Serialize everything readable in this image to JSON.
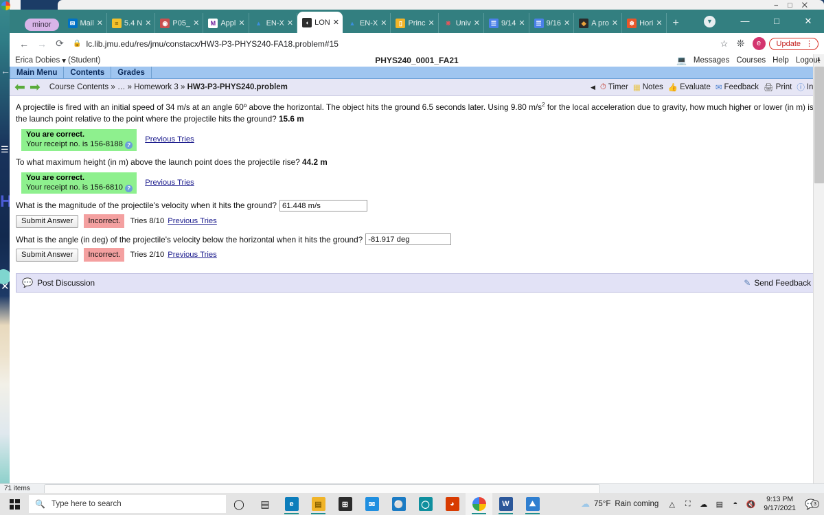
{
  "desktop": {
    "taskbar": {
      "search_placeholder": "Type here to search",
      "start_name": "windows-start",
      "apps": [
        {
          "name": "edge",
          "glyph": "e",
          "color": "#0c7dbb",
          "running": true
        },
        {
          "name": "file-explorer",
          "glyph": "▤",
          "color": "#f0b429",
          "running": true
        },
        {
          "name": "microsoft-store",
          "glyph": "⊞",
          "color": "#2b2b2b",
          "running": false
        },
        {
          "name": "mail",
          "glyph": "✉",
          "color": "#1f8fe0",
          "running": false
        },
        {
          "name": "skype",
          "glyph": "⊝",
          "color": "#1b7bc4",
          "running": false
        },
        {
          "name": "cortana",
          "glyph": "◯",
          "color": "#0f8f9e",
          "running": false
        },
        {
          "name": "office",
          "glyph": "◗",
          "color": "#d83b01",
          "running": false
        },
        {
          "name": "chrome",
          "glyph": "◉",
          "color": "#ffffff",
          "running": true,
          "active": true
        },
        {
          "name": "word",
          "glyph": "W",
          "color": "#2b579a",
          "running": true
        },
        {
          "name": "photos",
          "glyph": "⛰",
          "color": "#2f7fd0",
          "running": true
        }
      ],
      "weather_temp": "75°F",
      "weather_text": "Rain coming",
      "time": "9:13 PM",
      "date": "9/17/2021",
      "notification_count": "3",
      "tray_icons": [
        "chevron-up",
        "camera",
        "onedrive-sync",
        "battery",
        "wifi",
        "volume-mute"
      ]
    },
    "explorer_status": {
      "item_count": "71 items"
    }
  },
  "browser": {
    "pinned_tab_label": "minor",
    "tabs": [
      {
        "label": "Mail",
        "fav": "✉",
        "fav_color": "#0072c6",
        "active": false
      },
      {
        "label": "5.4 N",
        "fav": "≡",
        "fav_color": "#f3c12c",
        "active": false
      },
      {
        "label": "P05_",
        "fav": "◔",
        "fav_color": "#c94f4f",
        "active": false
      },
      {
        "label": "Appl",
        "fav": "M",
        "fav_color": "#6a1b9a",
        "active": false
      },
      {
        "label": "EN-X",
        "fav": "△",
        "fav_color": "#1a73e8",
        "active": false
      },
      {
        "label": "LON",
        "fav": "◕",
        "fav_color": "#333333",
        "active": true
      },
      {
        "label": "EN-X",
        "fav": "△",
        "fav_color": "#1a73e8",
        "active": false
      },
      {
        "label": "Princ",
        "fav": "▤",
        "fav_color": "#f0b429",
        "active": false
      },
      {
        "label": "Univ",
        "fav": "✹",
        "fav_color": "#e03a3a",
        "active": false
      },
      {
        "label": "9/14",
        "fav": "☰",
        "fav_color": "#4a80e8",
        "active": false
      },
      {
        "label": "9/16",
        "fav": "☰",
        "fav_color": "#4a80e8",
        "active": false
      },
      {
        "label": "A pro",
        "fav": "◆",
        "fav_color": "#e8a33d",
        "active": false
      },
      {
        "label": "Hori",
        "fav": "❄",
        "fav_color": "#e8562a",
        "active": false
      }
    ],
    "new_tab_glyph": "+",
    "window_controls": {
      "minimize": "—",
      "maximize": "□",
      "close": "✕"
    },
    "nav": {
      "back": "←",
      "forward": "→",
      "reload": "⟳"
    },
    "omnibox": {
      "lock_icon": "🔒",
      "url_host": "lc.lib.jmu.edu",
      "url_path": "/res/jmu/constacx/HW3-P3-PHYS240-FA18.problem#15"
    },
    "toolbar_right": {
      "bookmark_star": "☆",
      "extensions": "❖",
      "profile_initial": "e",
      "update_label": "Update",
      "kebab": "⋮"
    }
  },
  "lon_capa": {
    "user_line": "Erica Dobies",
    "user_caret": "▾",
    "user_role": "(Student)",
    "course_title": "PHYS240_0001_FA21",
    "top_links": [
      "Messages",
      "Courses",
      "Help",
      "Logout"
    ],
    "remote_icon": "remote-control-icon",
    "menu": [
      "Main Menu",
      "Contents",
      "Grades"
    ],
    "breadcrumb": {
      "prefix": "Course Contents » ",
      "ellipsis": "…",
      "mid": " » Homework 3 » ",
      "current": "HW3-P3-PHYS240.problem"
    },
    "tools": [
      {
        "label": "Timer",
        "icon": "timer-icon"
      },
      {
        "label": "Notes",
        "icon": "notes-icon"
      },
      {
        "label": "Evaluate",
        "icon": "thumbs-up-icon"
      },
      {
        "label": "Feedback",
        "icon": "feedback-icon"
      },
      {
        "label": "Print",
        "icon": "printer-icon"
      },
      {
        "label": "Info",
        "icon": "info-icon"
      }
    ],
    "tools_collapse": "◀",
    "problem": {
      "intro_part1": "A projectile is fired with an initial speed of 34 m/s at an angle 60º above the horizontal. The object hits the ground 6.5 seconds later. Using 9.80 m/s",
      "intro_sup": "2",
      "intro_part2": " for the local acceleration due to gravity, how much higher or lower (in m) is the launch point relative to the point where the projectile hits the ground? ",
      "intro_answer": "15.6 m",
      "parts": [
        {
          "status": "correct",
          "status_title": "You are correct.",
          "receipt": "Your receipt no. is 156-8188",
          "previous_tries": "Previous Tries"
        },
        {
          "question": "To what maximum height (in m) above the launch point does the projectile rise? ",
          "answer": "44.2 m",
          "status": "correct",
          "status_title": "You are correct.",
          "receipt": "Your receipt no. is 156-6810",
          "previous_tries": "Previous Tries"
        },
        {
          "question": "What is the magnitude of the projectile's velocity when it hits the ground?",
          "input_value": "61.448 m/s",
          "submit_label": "Submit Answer",
          "status": "incorrect",
          "status_label": "Incorrect.",
          "tries": "Tries 8/10",
          "previous_tries": "Previous Tries"
        },
        {
          "question": "What is the angle (in deg) of the projectile's velocity below the horizontal when it hits the ground?",
          "input_value": "-81.917 deg",
          "submit_label": "Submit Answer",
          "status": "incorrect",
          "status_label": "Incorrect.",
          "tries": "Tries 2/10",
          "previous_tries": "Previous Tries"
        }
      ]
    },
    "discussion": {
      "post_label": "Post Discussion",
      "post_icon": "discussion-bubble-icon",
      "feedback_label": "Send Feedback",
      "feedback_icon": "send-feedback-icon"
    }
  }
}
